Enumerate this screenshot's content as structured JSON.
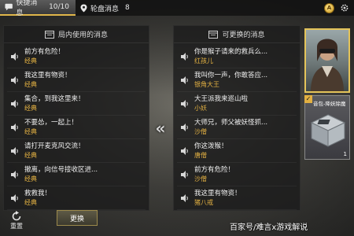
{
  "topbar": {
    "tab_quick": "快捷消息",
    "tab_quick_count": "10/10",
    "tab_wheel": "轮盘消息",
    "tab_wheel_count": "8"
  },
  "left_panel": {
    "title": "局内使用的消息",
    "items": [
      {
        "title": "前方有危险！",
        "sub": "经典"
      },
      {
        "title": "我这里有物资！",
        "sub": "经典"
      },
      {
        "title": "集合，到我这里来！",
        "sub": "经典"
      },
      {
        "title": "不要怂，一起上！",
        "sub": "经典"
      },
      {
        "title": "请打开麦克风交流！",
        "sub": "经典"
      },
      {
        "title": "撤离，向信号接收区进...",
        "sub": "经典"
      },
      {
        "title": "救救我！",
        "sub": "经典"
      }
    ]
  },
  "right_panel": {
    "title": "可更换的消息",
    "items": [
      {
        "title": "你是猴子请来的救兵么...",
        "sub": "红孩儿"
      },
      {
        "title": "我叫你一声，你敢答应...",
        "sub": "银角大王"
      },
      {
        "title": "大王派我来巡山啦",
        "sub": "小妖"
      },
      {
        "title": "大师兄，师父被妖怪抓...",
        "sub": "沙僧"
      },
      {
        "title": "你这泼猴！",
        "sub": "唐僧"
      },
      {
        "title": "前方有危险！",
        "sub": "沙僧"
      },
      {
        "title": "我这里有物资！",
        "sub": "猪八戒"
      }
    ]
  },
  "controls": {
    "reset_label": "重置",
    "replace_label": "更换"
  },
  "cards": {
    "box_label": "音包-降妖除魔",
    "box_count": "1"
  },
  "watermark": "百家号/难言x游戏解说",
  "colors": {
    "accent": "#e2b042",
    "panel_bg": "#1c1c1c"
  }
}
